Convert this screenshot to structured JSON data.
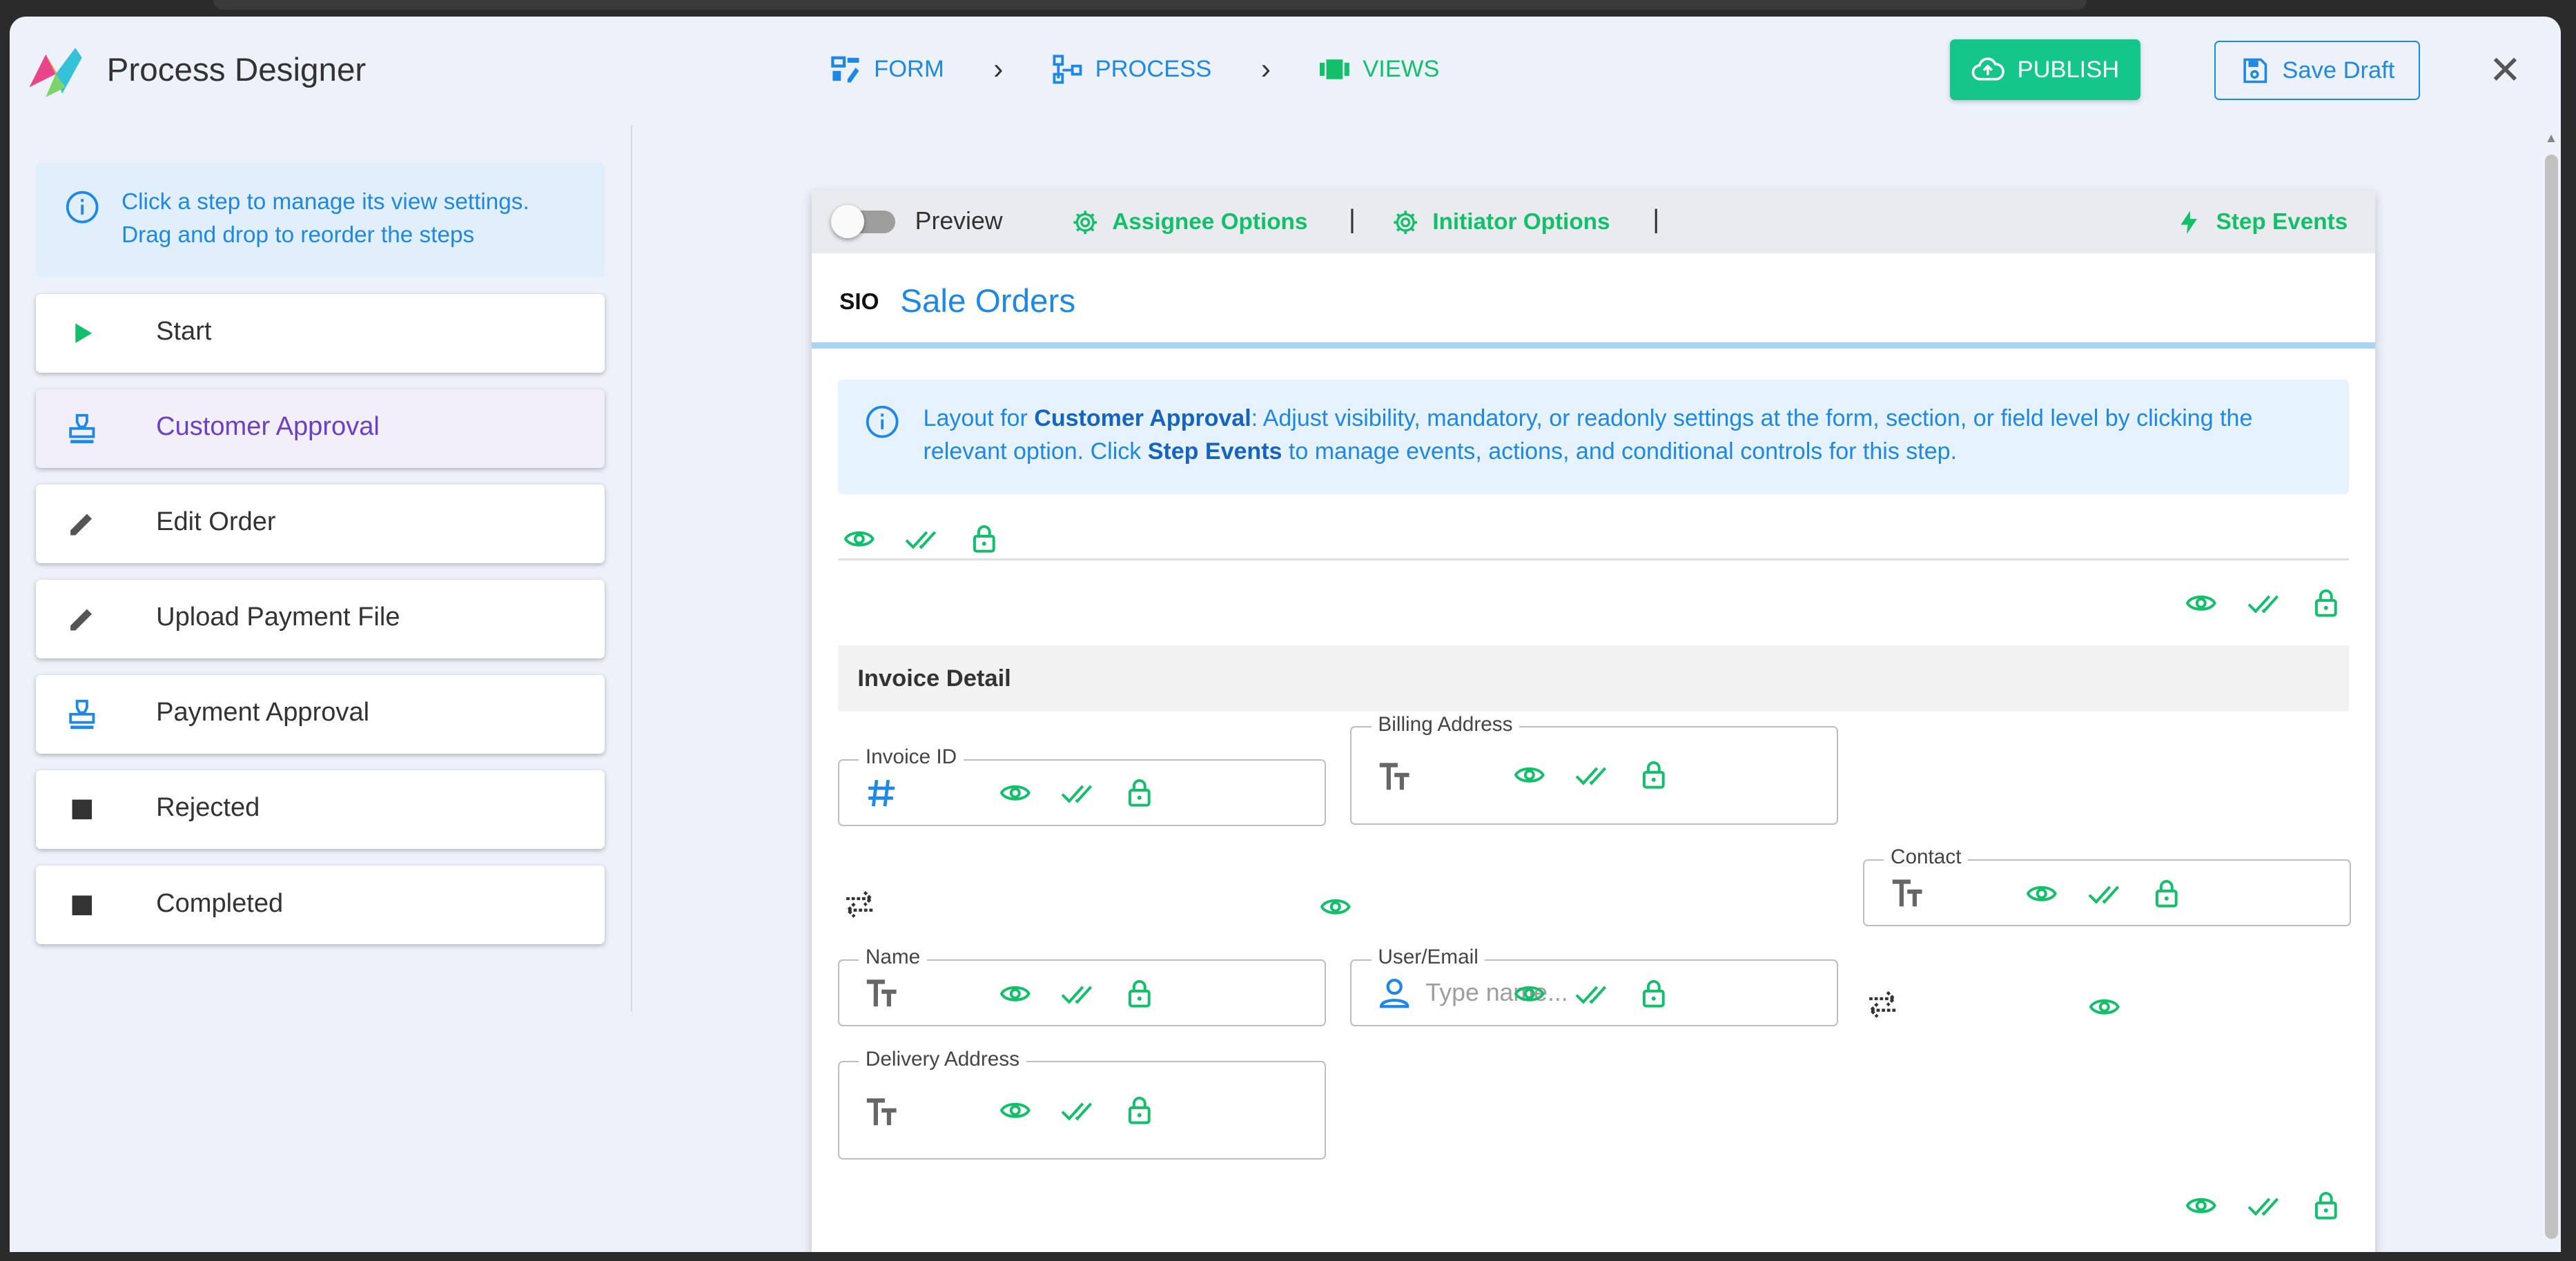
{
  "app": {
    "title": "Process Designer"
  },
  "nav": {
    "form": "FORM",
    "process": "PROCESS",
    "views": "VIEWS"
  },
  "actions": {
    "publish": "PUBLISH",
    "save_draft": "Save Draft"
  },
  "sidebar": {
    "hint_line1": "Click a step to manage its view settings.",
    "hint_line2": "Drag and drop to reorder the steps",
    "steps": [
      {
        "label": "Start",
        "icon": "play-icon"
      },
      {
        "label": "Customer Approval",
        "icon": "stamp-icon"
      },
      {
        "label": "Edit Order",
        "icon": "pencil-icon"
      },
      {
        "label": "Upload Payment File",
        "icon": "pencil-icon"
      },
      {
        "label": "Payment Approval",
        "icon": "stamp-icon"
      },
      {
        "label": "Rejected",
        "icon": "stop-icon"
      },
      {
        "label": "Completed",
        "icon": "stop-icon"
      }
    ]
  },
  "toolbar": {
    "preview": "Preview",
    "assignee_options": "Assignee Options",
    "initiator_options": "Initiator Options",
    "separator": "|",
    "step_events": "Step Events"
  },
  "form": {
    "code": "SIO",
    "title": "Sale Orders",
    "notice": {
      "prefix": "Layout for ",
      "step": "Customer Approval",
      "middle": ": Adjust visibility, mandatory, or readonly settings at the form, section, or field level by clicking the relevant option. Click ",
      "events": "Step Events",
      "suffix": " to manage events, actions, and conditional controls for this step."
    },
    "section_title": "Invoice Detail",
    "fields": {
      "invoice_id": "Invoice ID",
      "billing_address": "Billing Address",
      "contact": "Contact",
      "name": "Name",
      "user_email": "User/Email",
      "user_email_placeholder": "Type name...",
      "delivery_address": "Delivery Address"
    }
  },
  "colors": {
    "accent_blue": "#1e88e5",
    "accent_green": "#13bf6b",
    "active_purple": "#6a41c3",
    "publish_bg": "#15c68b"
  }
}
